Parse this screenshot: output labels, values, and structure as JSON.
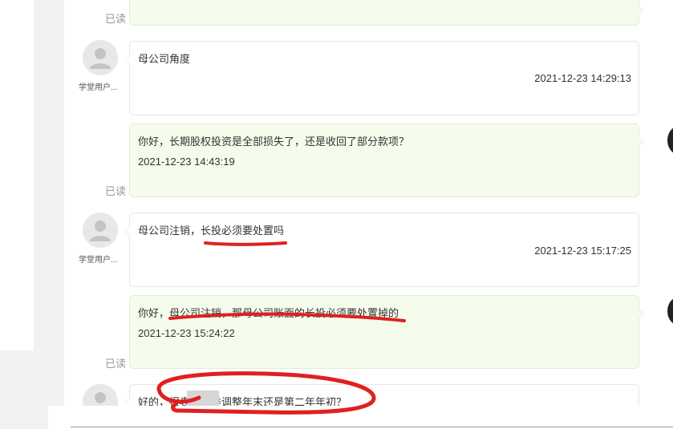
{
  "messages": [
    {
      "type": "sent",
      "text": "",
      "time": "",
      "status": "已读"
    },
    {
      "type": "received",
      "user": "学堂用户...",
      "text": "母公司角度",
      "time": "2021-12-23 14:29:13"
    },
    {
      "type": "sent",
      "text": "你好，长期股权投资是全部损失了，还是收回了部分款项？",
      "time": "2021-12-23 14:43:19",
      "status": "已读"
    },
    {
      "type": "received",
      "user": "学堂用户...",
      "text": "母公司注销，长投必须要处置吗",
      "time": "2021-12-23 15:17:25"
    },
    {
      "type": "sent",
      "text": "你好，母公司注销，那母公司账面的长投必须要处置掉的",
      "time": "2021-12-23 15:24:22",
      "status": "已读"
    },
    {
      "type": "received",
      "user": "",
      "text": "好的，报表重分类调整年末还是第二年年初？",
      "time": ""
    }
  ],
  "icons": {
    "avatar": "user-silhouette-icon"
  },
  "colors": {
    "sent_bubble": "#f5fcec",
    "received_bubble": "#ffffff",
    "annotation": "#e02020"
  }
}
